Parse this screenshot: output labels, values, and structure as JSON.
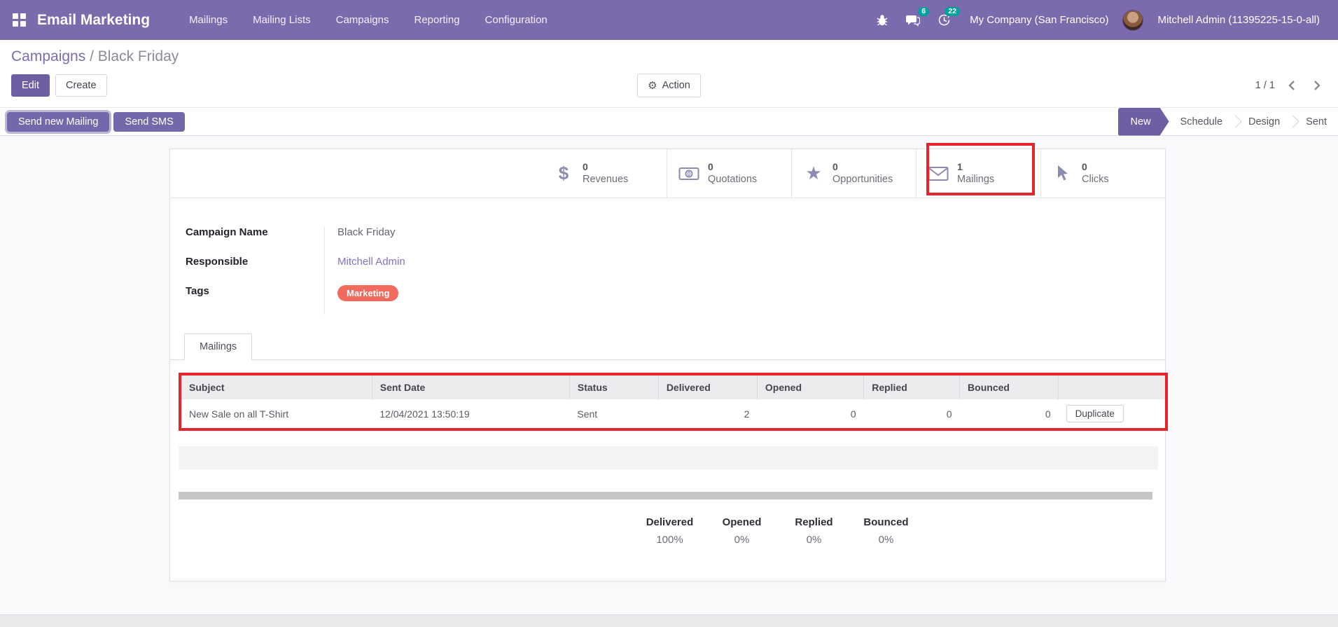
{
  "navbar": {
    "app_title": "Email Marketing",
    "menu_items": [
      "Mailings",
      "Mailing Lists",
      "Campaigns",
      "Reporting",
      "Configuration"
    ],
    "messages_count": "6",
    "activities_count": "22",
    "company": "My Company (San Francisco)",
    "user": "Mitchell Admin (11395225-15-0-all)"
  },
  "breadcrumb": {
    "parent": "Campaigns",
    "separator": " / ",
    "current": "Black Friday"
  },
  "control_panel": {
    "edit_label": "Edit",
    "create_label": "Create",
    "action_label": "Action",
    "gear_glyph": "⚙",
    "pager": "1 / 1"
  },
  "statusbar": {
    "buttons": [
      "Send new Mailing",
      "Send SMS"
    ],
    "stages": [
      {
        "label": "New",
        "active": true
      },
      {
        "label": "Schedule",
        "active": false
      },
      {
        "label": "Design",
        "active": false
      },
      {
        "label": "Sent",
        "active": false
      }
    ]
  },
  "stat_buttons": [
    {
      "icon": "dollar-icon",
      "value": "0",
      "label": "Revenues",
      "highlighted": false
    },
    {
      "icon": "money-bill-icon",
      "value": "0",
      "label": "Quotations",
      "highlighted": false
    },
    {
      "icon": "star-icon",
      "value": "0",
      "label": "Opportunities",
      "highlighted": false
    },
    {
      "icon": "envelope-icon",
      "value": "1",
      "label": "Mailings",
      "highlighted": true
    },
    {
      "icon": "mouse-pointer-icon",
      "value": "0",
      "label": "Clicks",
      "highlighted": false
    }
  ],
  "form": {
    "fields": [
      {
        "label": "Campaign Name",
        "value": "Black Friday"
      },
      {
        "label": "Responsible",
        "value": "Mitchell Admin"
      },
      {
        "label": "Tags",
        "value": "Marketing"
      }
    ]
  },
  "notebook": {
    "tab_label": "Mailings"
  },
  "mailings_table": {
    "columns": [
      "Subject",
      "Sent Date",
      "Status",
      "Delivered",
      "Opened",
      "Replied",
      "Bounced",
      ""
    ],
    "rows": [
      {
        "subject": "New Sale on all T-Shirt",
        "sent_date": "12/04/2021 13:50:19",
        "status": "Sent",
        "delivered": "2",
        "opened": "0",
        "replied": "0",
        "bounced": "0",
        "action": "Duplicate"
      }
    ]
  },
  "kpis": [
    {
      "label": "Delivered",
      "value": "100%"
    },
    {
      "label": "Opened",
      "value": "0%"
    },
    {
      "label": "Replied",
      "value": "0%"
    },
    {
      "label": "Bounced",
      "value": "0%"
    }
  ],
  "colors": {
    "navbar_bg": "#7b6bad",
    "primary_button": "#6e5fa3",
    "badge_teal": "#00a09d",
    "tag_marketing": "#f06a5d",
    "highlight_red": "#e6252b",
    "link_purple": "#8175bc"
  }
}
